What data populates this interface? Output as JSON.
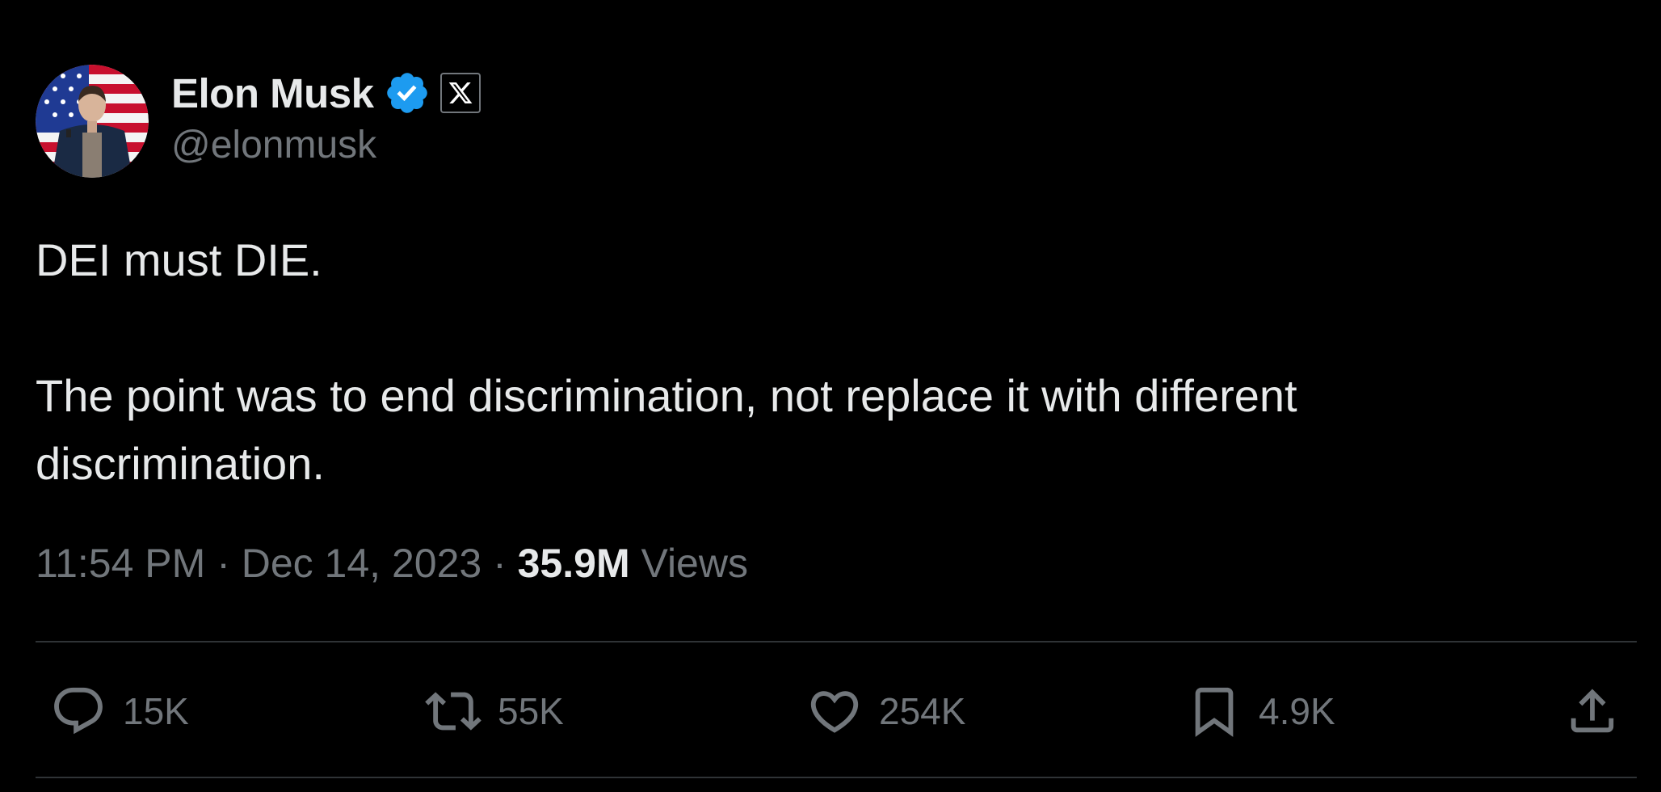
{
  "author": {
    "display_name": "Elon Musk",
    "handle": "@elonmusk",
    "verified_badge": "verified-check-icon",
    "affiliate_badge": "x-logo-icon"
  },
  "tweet": {
    "line1": "DEI must DIE.",
    "line2": "The point was to end discrimination, not replace it with different discrimination."
  },
  "meta": {
    "time": "11:54 PM",
    "separator": " · ",
    "date": "Dec 14, 2023",
    "views_count": "35.9M",
    "views_label": "Views"
  },
  "actions": {
    "reply_count": "15K",
    "repost_count": "55K",
    "like_count": "254K",
    "bookmark_count": "4.9K"
  },
  "colors": {
    "background": "#000000",
    "text_primary": "#e7e9ea",
    "text_secondary": "#71767b",
    "verified_blue": "#1d9bf0",
    "divider": "#2f3336"
  }
}
